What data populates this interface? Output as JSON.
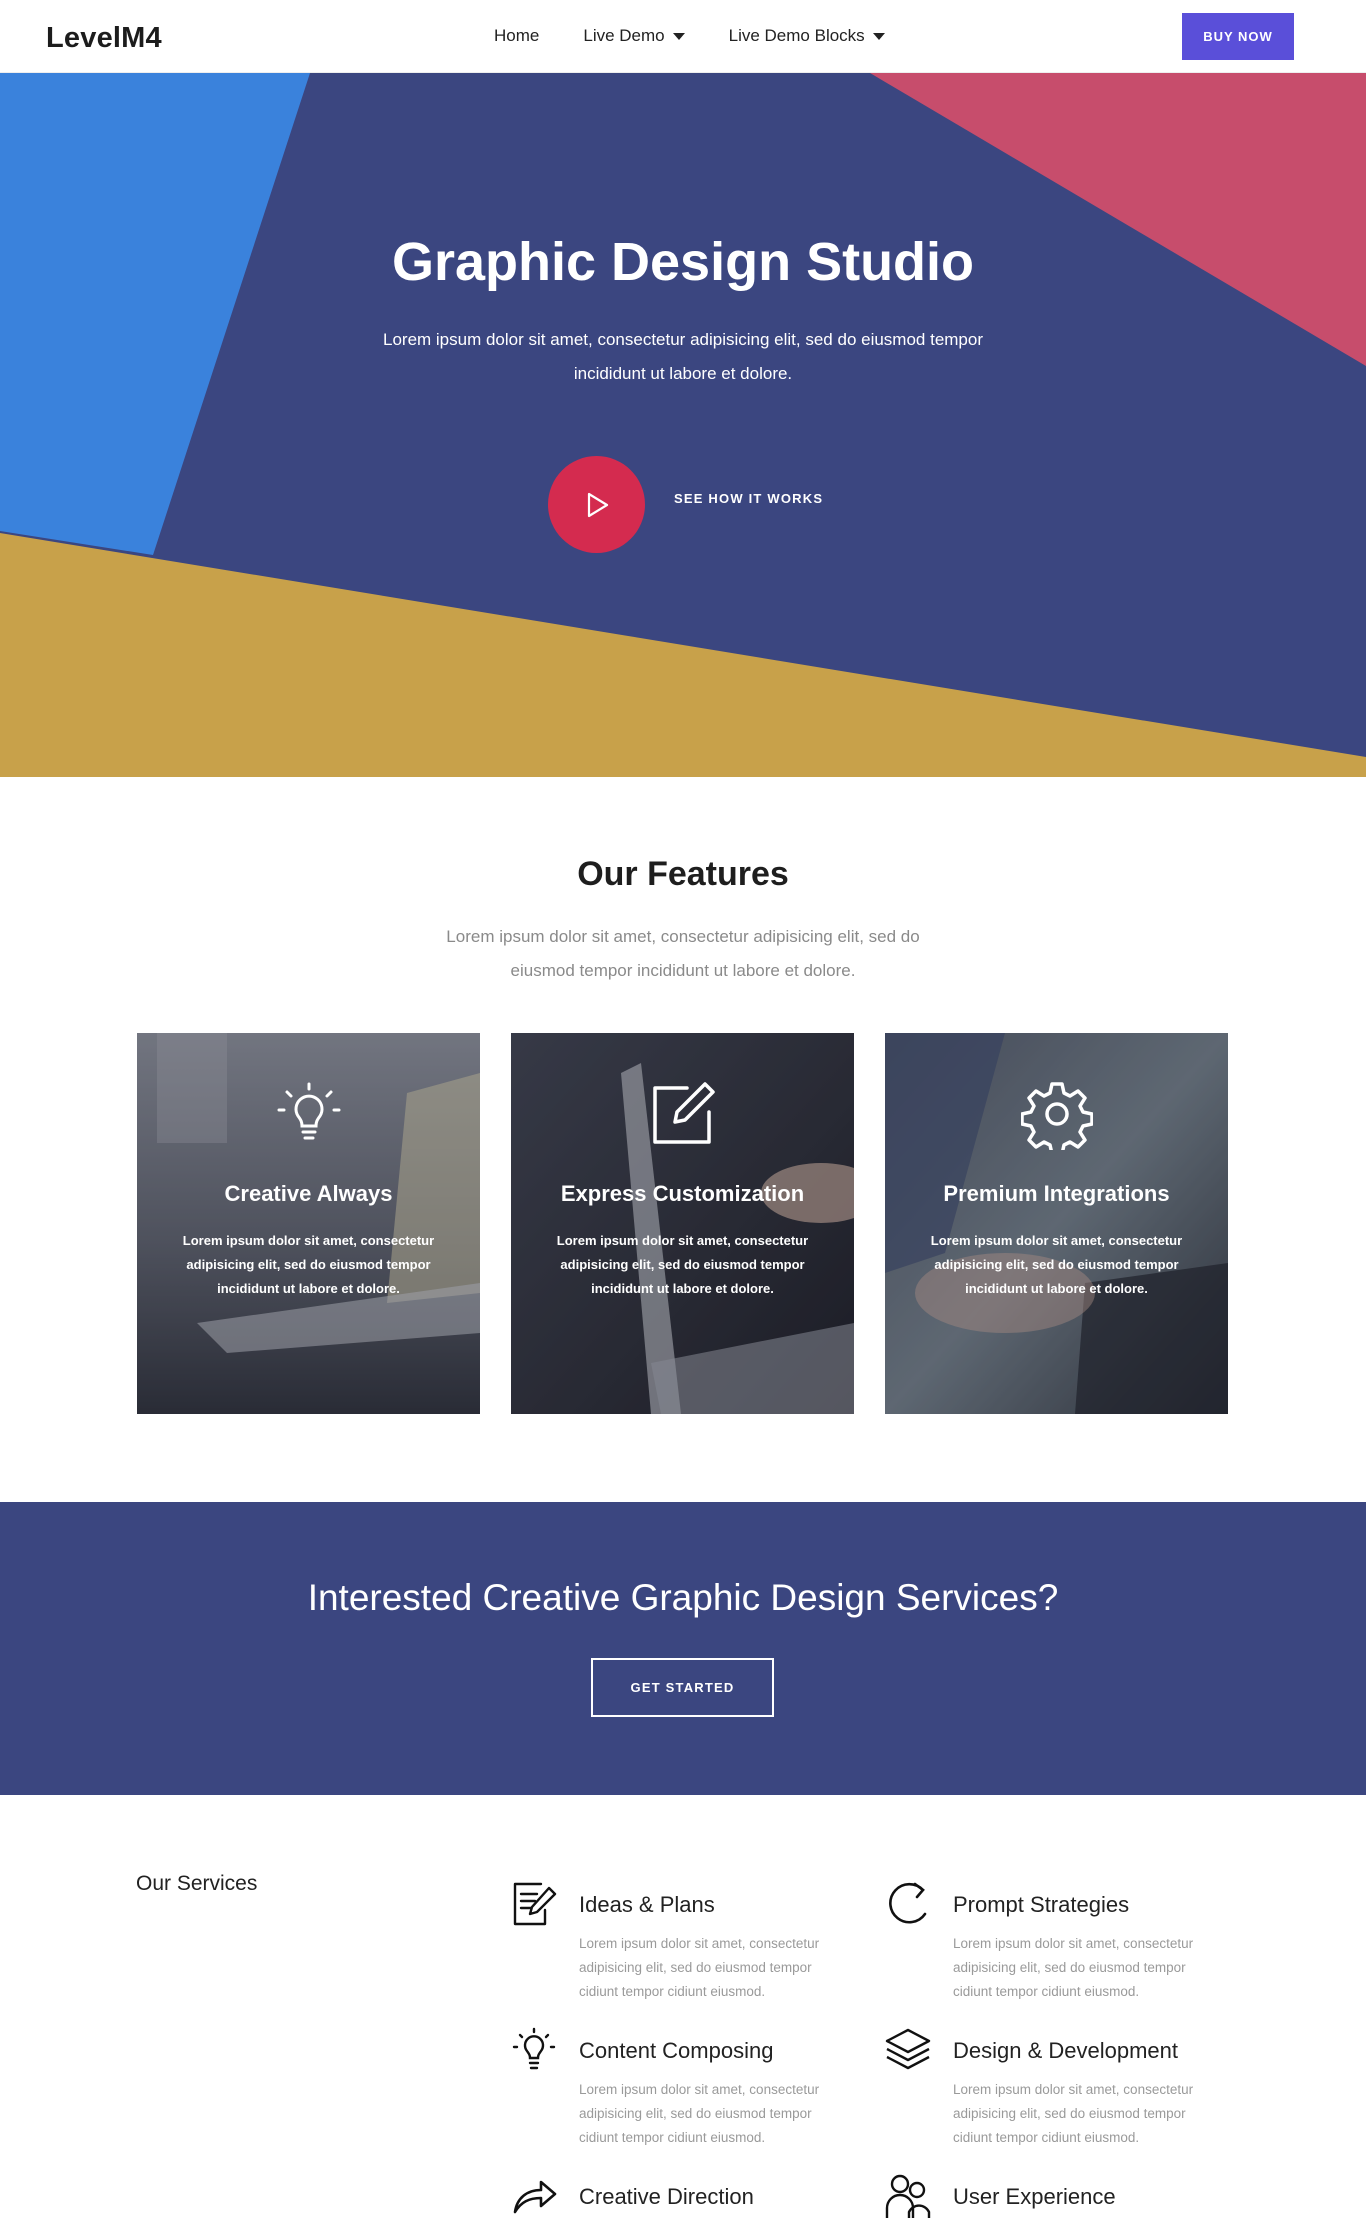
{
  "header": {
    "logo": "LevelM4",
    "nav": [
      {
        "label": "Home"
      },
      {
        "label": "Live Demo"
      },
      {
        "label": "Live Demo Blocks"
      }
    ],
    "buy_label": "BUY NOW"
  },
  "hero": {
    "title": "Graphic Design Studio",
    "subtitle": "Lorem ipsum dolor sit amet, consectetur adipisicing elit, sed do eiusmod tempor incididunt ut labore et dolore.",
    "cta_label": "SEE HOW IT WORKS",
    "colors": {
      "navy": "#3b4680",
      "blue": "#3a82dc",
      "red": "#c74d6c",
      "gold": "#c8a14a"
    }
  },
  "features": {
    "title": "Our Features",
    "subtitle": "Lorem ipsum dolor sit amet, consectetur adipisicing elit, sed do eiusmod tempor incididunt ut labore et dolore.",
    "cards": [
      {
        "icon": "lightbulb-icon",
        "title": "Creative Always",
        "text": "Lorem ipsum dolor sit amet, consectetur adipisicing elit, sed do eiusmod tempor incididunt ut labore et dolore."
      },
      {
        "icon": "edit-icon",
        "title": "Express Customization",
        "text": "Lorem ipsum dolor sit amet, consectetur adipisicing elit, sed do eiusmod tempor incididunt ut labore et dolore."
      },
      {
        "icon": "gear-icon",
        "title": "Premium Integrations",
        "text": "Lorem ipsum dolor sit amet, consectetur adipisicing elit, sed do eiusmod tempor incididunt ut labore et dolore."
      }
    ]
  },
  "cta": {
    "title": "Interested Creative Graphic Design Services?",
    "button_label": "GET STARTED"
  },
  "services": {
    "heading": "Our Services",
    "items": [
      {
        "icon": "document-edit-icon",
        "title": "Ideas & Plans",
        "text": "Lorem ipsum dolor sit amet, consectetur adipisicing elit, sed do eiusmod tempor cidiunt tempor cidiunt eiusmod."
      },
      {
        "icon": "refresh-icon",
        "title": "Prompt Strategies",
        "text": "Lorem ipsum dolor sit amet, consectetur adipisicing elit, sed do eiusmod tempor cidiunt tempor cidiunt eiusmod."
      },
      {
        "icon": "lightbulb-icon",
        "title": "Content Composing",
        "text": "Lorem ipsum dolor sit amet, consectetur adipisicing elit, sed do eiusmod tempor cidiunt tempor cidiunt eiusmod."
      },
      {
        "icon": "layers-icon",
        "title": "Design & Development",
        "text": "Lorem ipsum dolor sit amet, consectetur adipisicing elit, sed do eiusmod tempor cidiunt tempor cidiunt eiusmod."
      },
      {
        "icon": "share-arrow-icon",
        "title": "Creative Direction",
        "text": ""
      },
      {
        "icon": "users-icon",
        "title": "User Experience",
        "text": ""
      }
    ]
  }
}
